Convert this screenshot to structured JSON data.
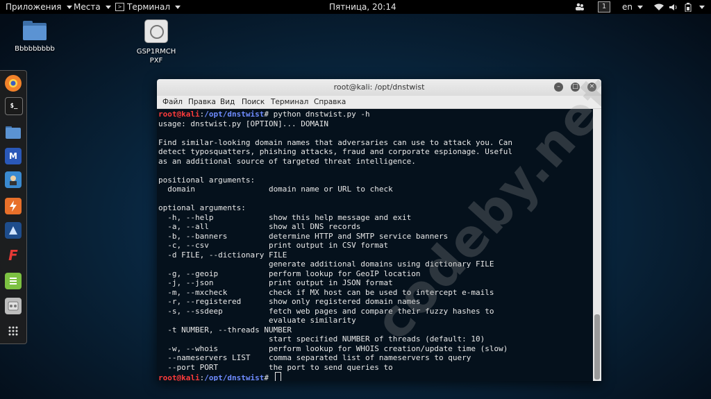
{
  "topbar": {
    "apps_label": "Приложения",
    "places_label": "Места",
    "terminal_label": "Терминал",
    "clock": "Пятница, 20:14",
    "workspace": "1",
    "lang": "en"
  },
  "desktop": {
    "icons": [
      {
        "label": "Bbbbbbbbb"
      },
      {
        "label": "GSP1RMCH PXF"
      }
    ]
  },
  "dock": {
    "items": [
      "firefox-icon",
      "terminal-icon",
      "files-icon",
      "metasploit-icon",
      "armitage-icon",
      "burpsuite-icon",
      "beef-icon",
      "faraday-icon",
      "leafpad-icon",
      "cherrytree-icon",
      "show-apps-icon"
    ]
  },
  "window": {
    "title": "root@kali: /opt/dnstwist",
    "menu": [
      "Файл",
      "Правка",
      "Вид",
      "Поиск",
      "Терминал",
      "Справка"
    ]
  },
  "terminal": {
    "prompt_user": "root@kali",
    "prompt_sep": ":",
    "prompt_path": "/opt/dnstwist",
    "prompt_end": "# ",
    "command": "python dnstwist.py -h",
    "output": [
      "usage: dnstwist.py [OPTION]... DOMAIN",
      "",
      "Find similar-looking domain names that adversaries can use to attack you. Can",
      "detect typosquatters, phishing attacks, fraud and corporate espionage. Useful",
      "as an additional source of targeted threat intelligence.",
      "",
      "positional arguments:",
      "  domain                domain name or URL to check",
      "",
      "optional arguments:",
      "  -h, --help            show this help message and exit",
      "  -a, --all             show all DNS records",
      "  -b, --banners         determine HTTP and SMTP service banners",
      "  -c, --csv             print output in CSV format",
      "  -d FILE, --dictionary FILE",
      "                        generate additional domains using dictionary FILE",
      "  -g, --geoip           perform lookup for GeoIP location",
      "  -j, --json            print output in JSON format",
      "  -m, --mxcheck         check if MX host can be used to intercept e-mails",
      "  -r, --registered      show only registered domain names",
      "  -s, --ssdeep          fetch web pages and compare their fuzzy hashes to",
      "                        evaluate similarity",
      "  -t NUMBER, --threads NUMBER",
      "                        start specified NUMBER of threads (default: 10)",
      "  -w, --whois           perform lookup for WHOIS creation/update time (slow)",
      "  --nameservers LIST    comma separated list of nameservers to query",
      "  --port PORT           the port to send queries to"
    ]
  },
  "watermark": "codeby.net"
}
